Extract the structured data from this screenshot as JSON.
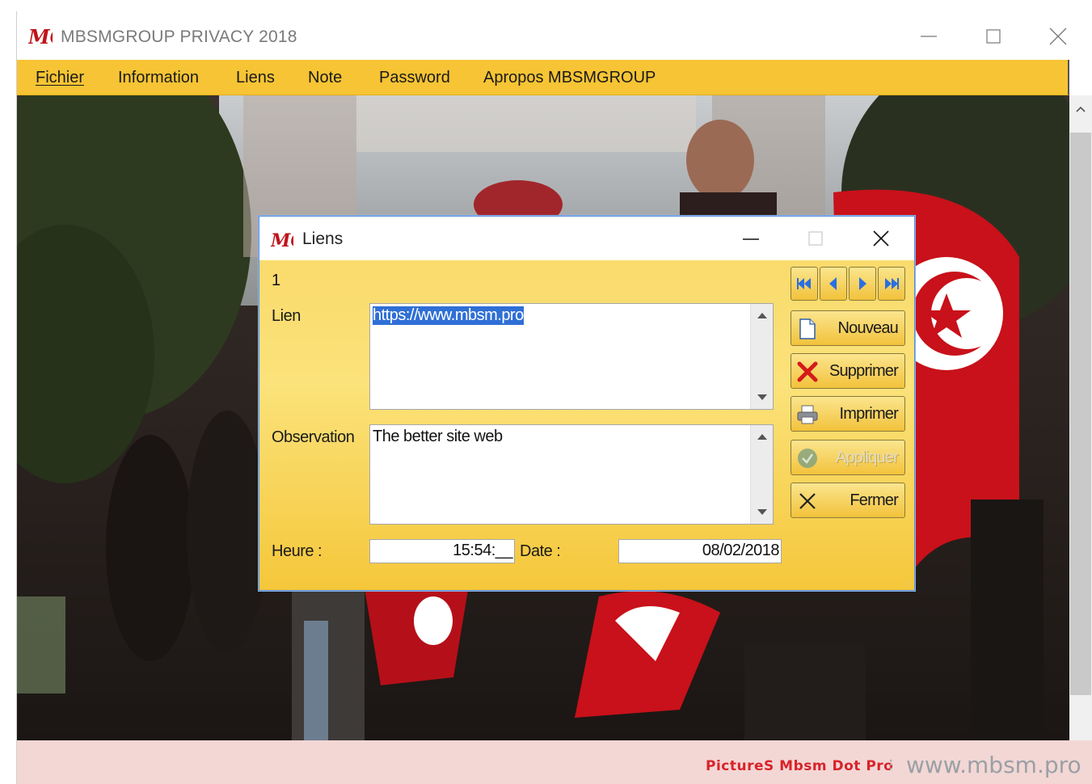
{
  "window": {
    "title": "MBSMGROUP PRIVACY 2018",
    "minimize_glyph": "—",
    "maximize_glyph": "☐",
    "close_glyph": "✕"
  },
  "menu": {
    "items": [
      {
        "label": "Fichier"
      },
      {
        "label": "Information"
      },
      {
        "label": "Liens"
      },
      {
        "label": "Note"
      },
      {
        "label": "Password"
      },
      {
        "label": "Apropos MBSMGROUP"
      }
    ]
  },
  "dialog": {
    "title": "Liens",
    "record_number": "1",
    "lien_label": "Lien",
    "lien_value": "https://www.mbsm.pro",
    "observation_label": "Observation",
    "observation_value": "The better site web",
    "heure_label": "Heure :",
    "heure_value": "15:54:__",
    "date_label": "Date :",
    "date_value": "08/02/2018",
    "buttons": {
      "nouveau": "Nouveau",
      "supprimer": "Supprimer",
      "imprimer": "Imprimer",
      "appliquer": "Appliquer",
      "fermer": "Fermer"
    }
  },
  "watermark": {
    "left": "PictureS Mbsm Dot Pro",
    "separator": "⁝",
    "right": "www.mbsm.pro"
  },
  "colors": {
    "menubar": "#f6c434",
    "dialog_bg": "#fbe27a",
    "accent_blue": "#2f6fd6",
    "brand_red": "#d8232a"
  },
  "icons": [
    "mg-logo-icon",
    "first-record-icon",
    "prev-record-icon",
    "next-record-icon",
    "last-record-icon",
    "new-document-icon",
    "delete-x-icon",
    "printer-icon",
    "apply-check-icon",
    "close-x-icon"
  ]
}
